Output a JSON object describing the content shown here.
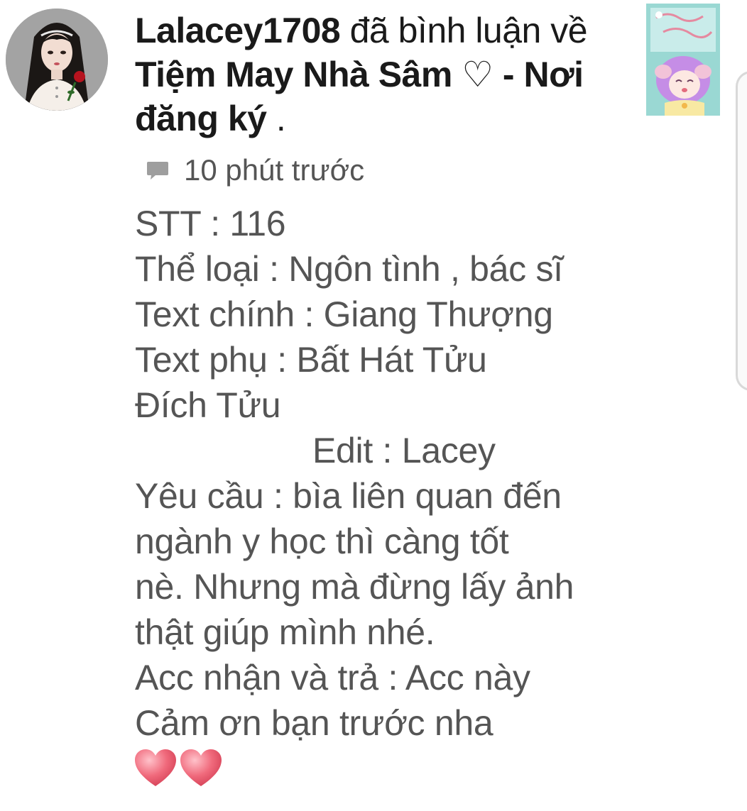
{
  "notification": {
    "username": "Lalacey1708",
    "action": "đã bình luận về",
    "story_title": "Tiệm May Nhà Sâm ♡ - Nơi đăng ký",
    "trailing": ".",
    "timestamp": "10 phút trước",
    "icons": {
      "comment": "comment-bubble-icon",
      "heart": "heart-emoji"
    },
    "colors": {
      "primary_text": "#1a1a1a",
      "secondary_text": "#555555",
      "heart": "#f06a7c"
    }
  },
  "comment": {
    "lines": [
      "STT : 116",
      "Thể loại : Ngôn tình , bác sĩ",
      "Text chính : Giang Thượng",
      "Text phụ : Bất Hát Tửu",
      "Đích Tửu",
      "Edit : Lacey",
      "Yêu cầu : bìa liên quan đến",
      "ngành y học thì càng tốt",
      "nè. Nhưng mà đừng lấy ảnh",
      "thật giúp mình nhé.",
      "Acc nhận và trả : Acc này",
      "Cảm ơn bạn trước nha"
    ],
    "emoji": "❤❤"
  }
}
